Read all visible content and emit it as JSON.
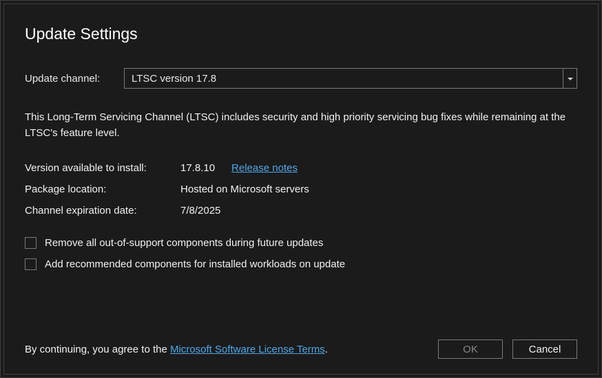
{
  "title": "Update Settings",
  "channel": {
    "label": "Update channel:",
    "selected": "LTSC version 17.8"
  },
  "description": "This Long-Term Servicing Channel (LTSC) includes security and high priority servicing bug fixes while remaining at the LTSC's feature level.",
  "info": {
    "version_label": "Version available to install:",
    "version_value": "17.8.10",
    "release_notes_link": "Release notes",
    "package_label": "Package location:",
    "package_value": "Hosted on Microsoft servers",
    "expiration_label": "Channel expiration date:",
    "expiration_value": "7/8/2025"
  },
  "checkboxes": {
    "remove_label": "Remove all out-of-support components during future updates",
    "add_label": "Add recommended components for installed workloads on update"
  },
  "footer": {
    "terms_prefix": "By continuing, you agree to the ",
    "terms_link": "Microsoft Software License Terms",
    "terms_suffix": ".",
    "ok_label": "OK",
    "cancel_label": "Cancel"
  }
}
